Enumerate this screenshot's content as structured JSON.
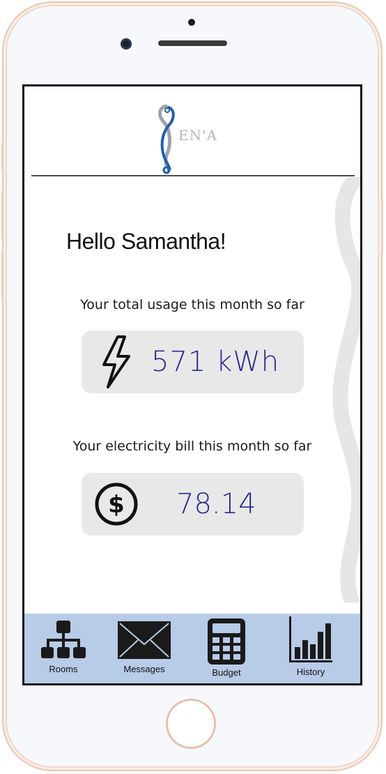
{
  "brand": {
    "logo_text": "EN'A",
    "accent_color": "#1f5fae"
  },
  "greeting": "Hello Samantha!",
  "usage": {
    "label": "Your total usage this month so far",
    "value": "571  kWh",
    "icon": "lightning-icon"
  },
  "bill": {
    "label": "Your electricity bill this month so far",
    "value": "78.14",
    "icon": "dollar-icon"
  },
  "nav": {
    "items": [
      {
        "label": "Rooms",
        "icon": "sitemap-icon"
      },
      {
        "label": "Messages",
        "icon": "envelope-icon"
      },
      {
        "label": "Budget",
        "icon": "calculator-icon"
      },
      {
        "label": "History",
        "icon": "bar-chart-icon"
      }
    ],
    "background": "#b8cbe7"
  },
  "colors": {
    "value_text": "#2a2a8c",
    "card_bg": "#e8e8e8"
  }
}
